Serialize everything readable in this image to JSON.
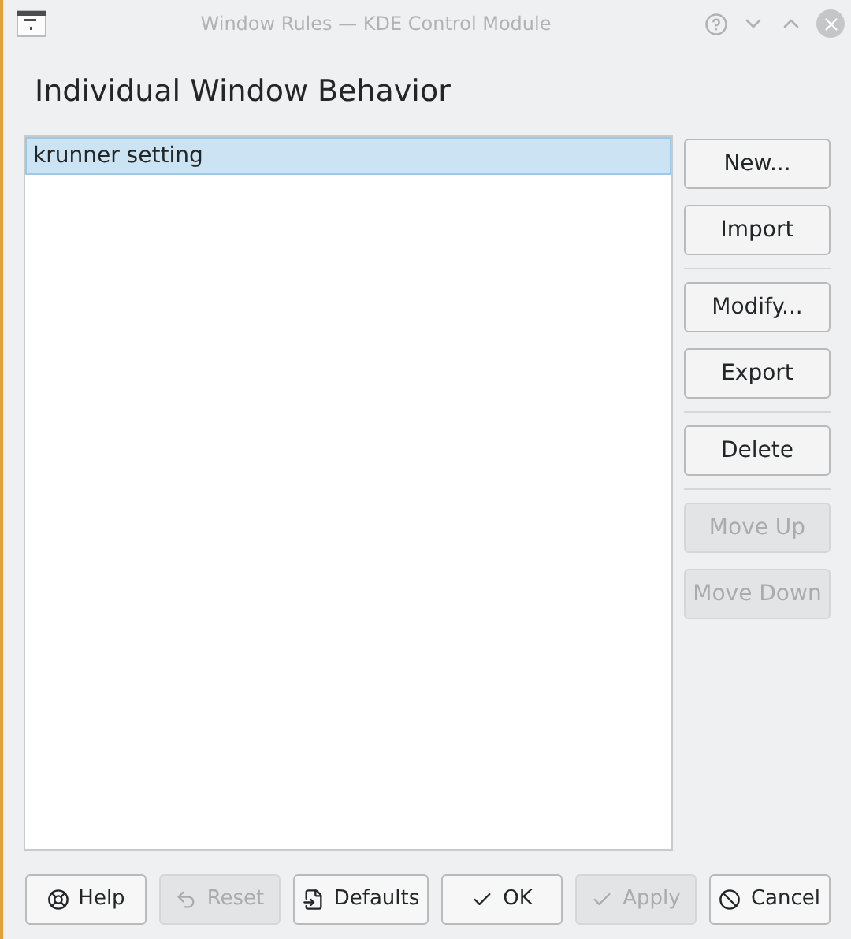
{
  "window": {
    "title": "Window Rules — KDE Control Module"
  },
  "heading": "Individual Window Behavior",
  "rules": [
    {
      "label": "krunner setting",
      "selected": true
    }
  ],
  "side_groups": [
    [
      {
        "label": "New...",
        "disabled": false
      },
      {
        "label": "Import",
        "disabled": false
      }
    ],
    [
      {
        "label": "Modify...",
        "disabled": false
      },
      {
        "label": "Export",
        "disabled": false
      }
    ],
    [
      {
        "label": "Delete",
        "disabled": false
      }
    ],
    [
      {
        "label": "Move Up",
        "disabled": true
      },
      {
        "label": "Move Down",
        "disabled": true
      }
    ]
  ],
  "buttons": [
    {
      "kind": "help",
      "label": "Help",
      "disabled": false
    },
    {
      "kind": "reset",
      "label": "Reset",
      "disabled": true
    },
    {
      "kind": "defaults",
      "label": "Defaults",
      "disabled": false
    },
    {
      "kind": "ok",
      "label": "OK",
      "disabled": false
    },
    {
      "kind": "apply",
      "label": "Apply",
      "disabled": true
    },
    {
      "kind": "cancel",
      "label": "Cancel",
      "disabled": false
    }
  ]
}
